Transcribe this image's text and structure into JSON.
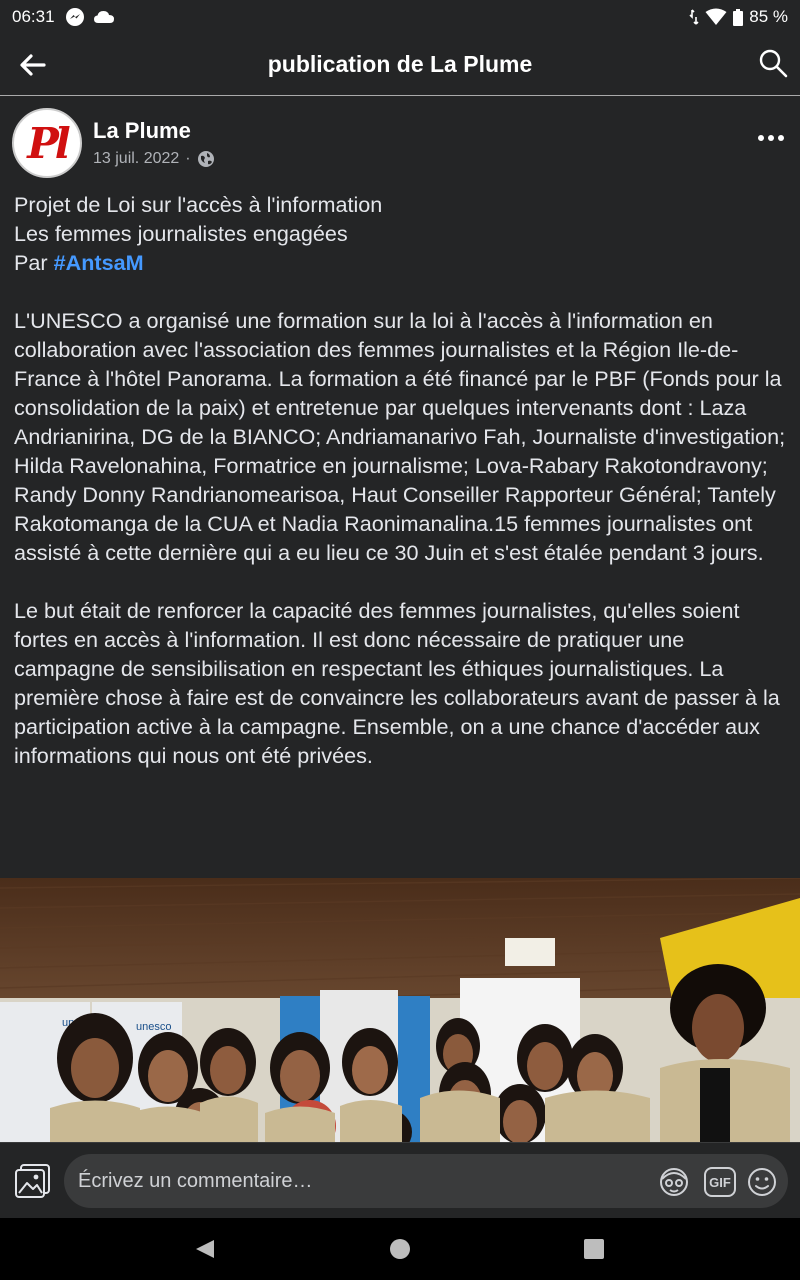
{
  "status_bar": {
    "time": "06:31",
    "battery": "85 %"
  },
  "top_bar": {
    "title": "publication de La Plume"
  },
  "post": {
    "author": "La Plume",
    "avatar_text": "Pl",
    "date": "13 juil. 2022",
    "separator": "·",
    "lines_intro": [
      "Projet de Loi sur l'accès à l'information",
      "Les femmes journalistes engagées"
    ],
    "by_prefix": "Par ",
    "hashtag": "#AntsaM",
    "paragraph1": "L'UNESCO a organisé une formation sur la loi à l'accès à l'information en collaboration avec l'association des femmes journalistes et la Région Ile-de-France à l'hôtel Panorama. La formation a été financé par le PBF (Fonds pour la consolidation de la paix) et entretenue par quelques intervenants dont : Laza Andrianirina, DG de la BIANCO; Andriamanarivo Fah, Journaliste d'investigation; Hilda Ravelonahina, Formatrice en journalisme; Lova-Rabary Rakotondravony; Randy Donny Randrianomearisoa, Haut Conseiller Rapporteur Général; Tantely Rakotomanga de la CUA et Nadia Raonimanalina.15 femmes journalistes ont assisté à cette dernière qui a eu lieu ce 30 Juin et s'est étalée pendant 3 jours.",
    "paragraph2": "Le but était de renforcer la capacité des femmes journalistes, qu'elles soient fortes en accès à l'information. Il est donc nécessaire de pratiquer une campagne de sensibilisation en respectant les éthiques journalistiques. La première chose à faire est de convaincre les collaborateurs avant de passer à la participation active à la campagne. Ensemble, on a une chance d'accéder aux informations qui nous ont été privées.",
    "photo_banner_text": "unesco"
  },
  "comment_bar": {
    "placeholder": "Écrivez un commentaire…",
    "gif_label": "GIF"
  },
  "colors": {
    "background": "#242526",
    "link": "#4599ff",
    "input": "#3a3b3c"
  },
  "icons": [
    "messenger-icon",
    "cloud-icon",
    "data-icon",
    "wifi-icon",
    "battery-icon",
    "back-arrow-icon",
    "search-icon",
    "globe-icon",
    "more-icon",
    "photo-icon",
    "avatar-sticker-icon",
    "gif-icon",
    "emoji-icon",
    "nav-back-icon",
    "nav-home-icon",
    "nav-recents-icon"
  ]
}
